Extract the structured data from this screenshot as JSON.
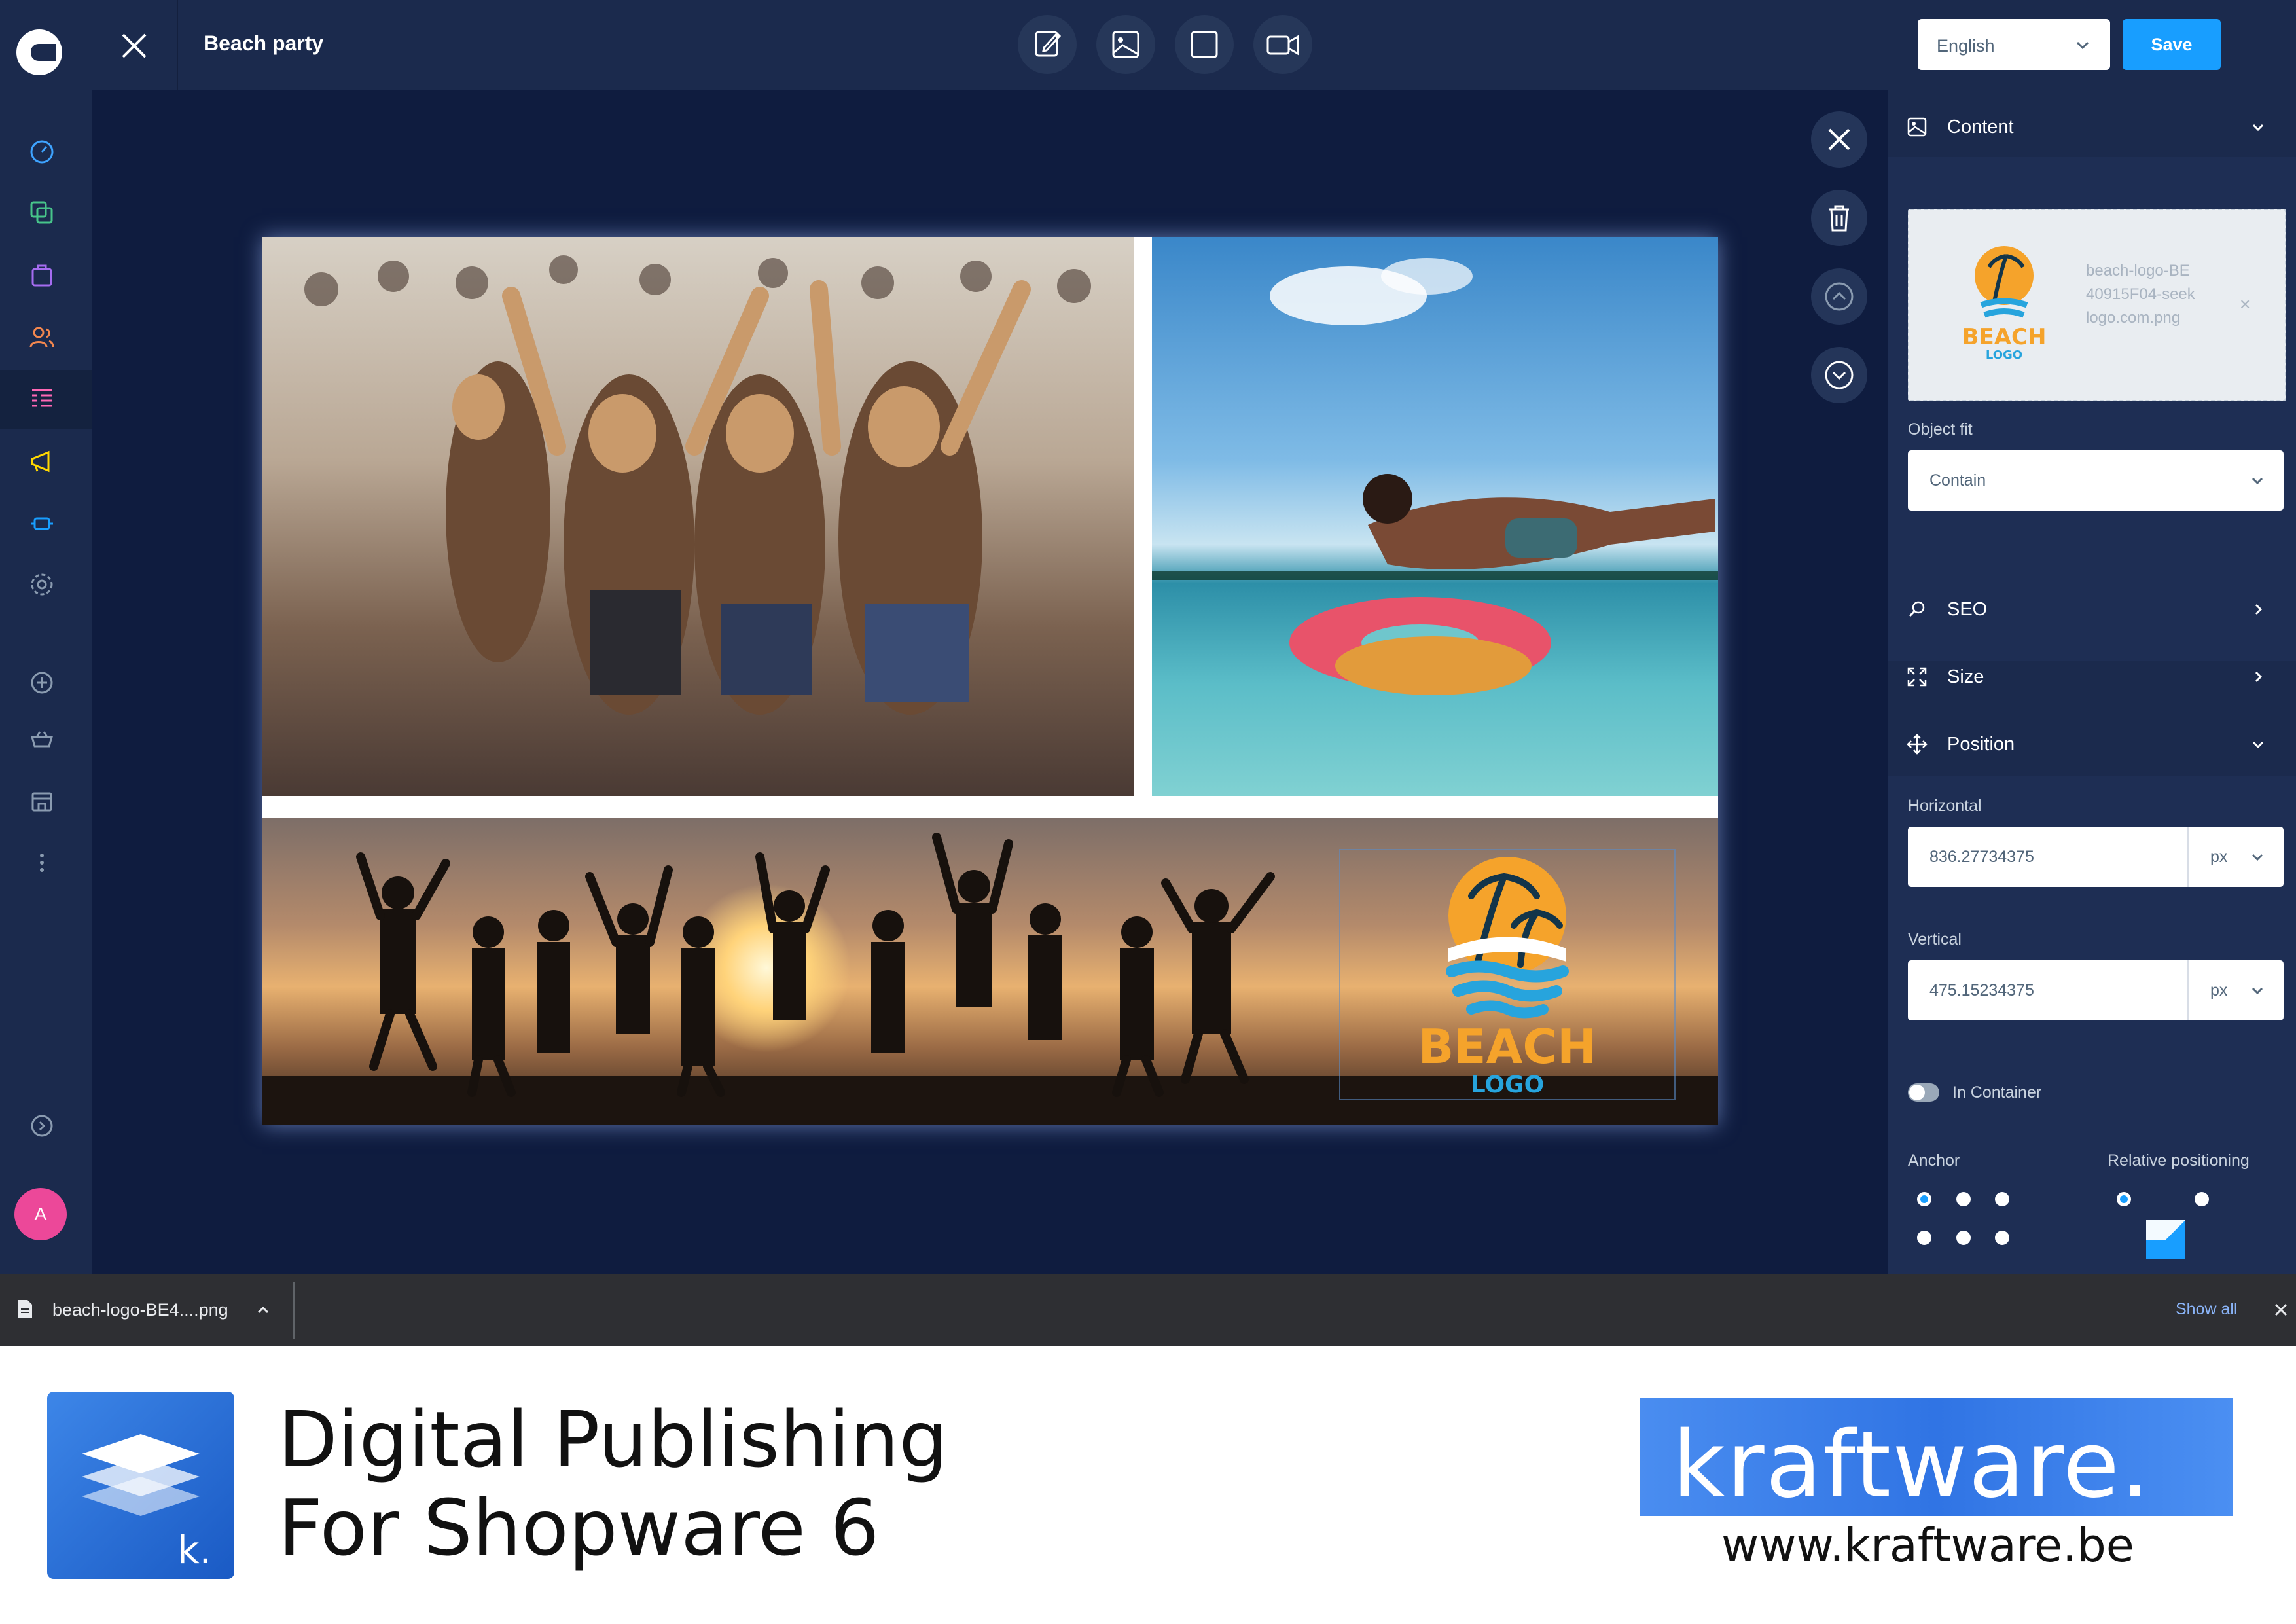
{
  "header": {
    "title": "Beach party",
    "language": "English",
    "save_label": "Save",
    "tools": [
      "edit-icon",
      "image-icon",
      "square-icon",
      "video-icon"
    ]
  },
  "sidebar": {
    "items": [
      "dashboard-icon",
      "catalogue-icon",
      "orders-icon",
      "customers-icon",
      "content-icon",
      "marketing-icon",
      "extensions-icon",
      "settings-icon",
      "add-icon",
      "sales-channel-basket-icon",
      "storefront-icon",
      "more-icon",
      "help-icon"
    ],
    "avatar_initial": "A"
  },
  "canvas": {
    "logo_word": "BEACH",
    "logo_subword": "LOGO"
  },
  "panel": {
    "content_title": "Content",
    "media_filename": "beach-logo-BE40915F04-seeklogo.com.png",
    "media_logo_word": "BEACH",
    "media_logo_subword": "LOGO",
    "object_fit_label": "Object fit",
    "object_fit_value": "Contain",
    "seo_title": "SEO",
    "size_title": "Size",
    "position_title": "Position",
    "horizontal_label": "Horizontal",
    "horizontal_value": "836.27734375",
    "horizontal_unit": "px",
    "vertical_label": "Vertical",
    "vertical_value": "475.15234375",
    "vertical_unit": "px",
    "in_container_label": "In Container",
    "anchor_label": "Anchor",
    "relative_label": "Relative positioning"
  },
  "downloads": {
    "file": "beach-logo-BE4....png",
    "show_all": "Show all"
  },
  "banner": {
    "line1": "Digital Publishing",
    "line2": "For Shopware 6",
    "tile_letter": "k.",
    "brand": "kraftware.",
    "url": "www.kraftware.be"
  },
  "colors": {
    "accent": "#189eff",
    "sidebar": "#1b2a4d",
    "canvas_bg": "#0f1c3f",
    "banner_blue": "#3074e4"
  }
}
